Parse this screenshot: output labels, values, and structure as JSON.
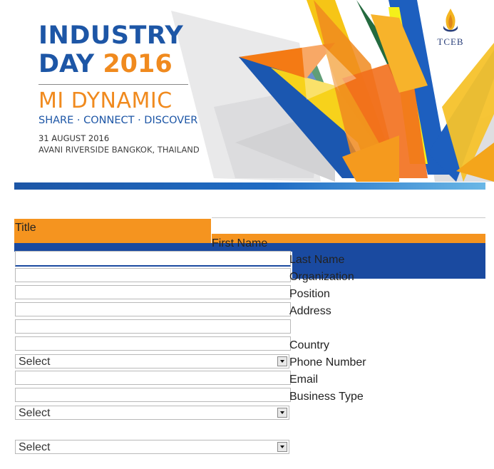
{
  "banner": {
    "line1": "INDUSTRY",
    "line2_a": "DAY ",
    "line2_b": "2016",
    "line3": "MI DYNAMIC",
    "line4": "SHARE · CONNECT · DISCOVER",
    "date": "31 AUGUST 2016",
    "venue": "AVANI RIVERSIDE BANGKOK, THAILAND",
    "logo_text": "TCEB",
    "colors": {
      "blue": "#1d56a6",
      "orange": "#f08a1e"
    }
  },
  "form": {
    "labels": {
      "title": "Title",
      "first_name": "First Name",
      "last_name": "Last Name",
      "organization": "Organization",
      "position": "Position",
      "address": "Address",
      "country": "Country",
      "phone": "Phone Number",
      "email": "Email",
      "business_type": "Business Type"
    },
    "selects": {
      "country_value": "Select",
      "business_type_value": "Select",
      "extra_value": "Select"
    },
    "colors": {
      "orange": "#f5941f",
      "blue": "#1a4aa0"
    }
  }
}
